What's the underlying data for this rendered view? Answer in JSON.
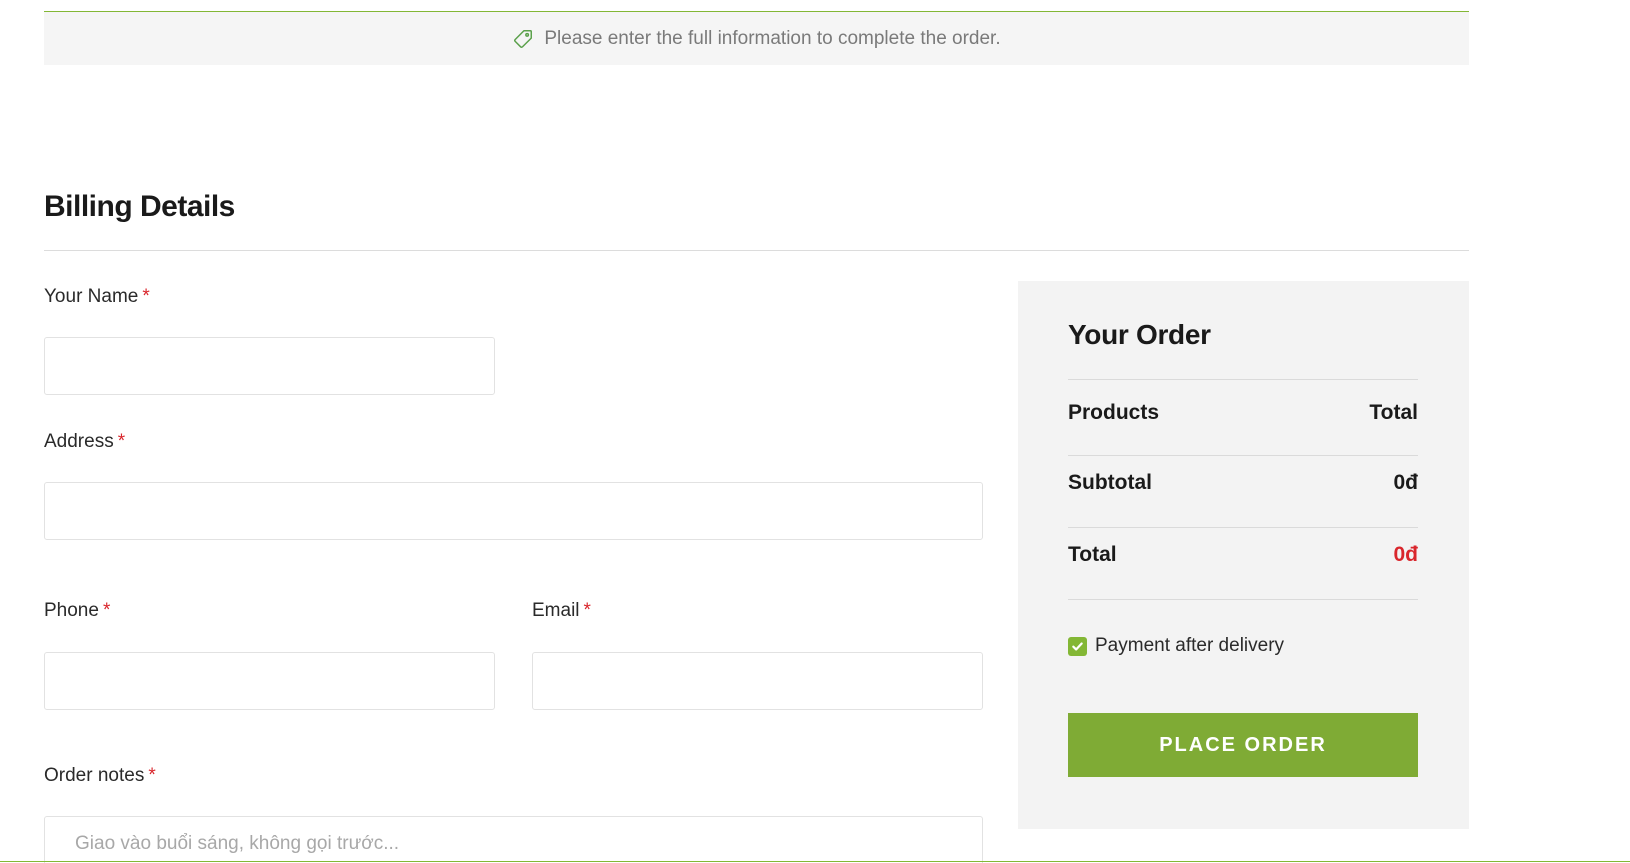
{
  "notice": {
    "icon": "tag-icon",
    "text": "Please enter the full information to complete the order."
  },
  "billing": {
    "title": "Billing Details",
    "required_mark": "*",
    "fields": {
      "name": {
        "label": "Your Name",
        "value": "",
        "placeholder": ""
      },
      "address": {
        "label": "Address",
        "value": "",
        "placeholder": ""
      },
      "phone": {
        "label": "Phone",
        "value": "",
        "placeholder": ""
      },
      "email": {
        "label": "Email",
        "value": "",
        "placeholder": ""
      },
      "notes": {
        "label": "Order notes",
        "value": "",
        "placeholder": "Giao vào buổi sáng, không gọi trước..."
      }
    }
  },
  "order": {
    "title": "Your Order",
    "products_label": "Products",
    "total_header": "Total",
    "subtotal_label": "Subtotal",
    "subtotal_value": "0đ",
    "total_label": "Total",
    "total_value": "0đ",
    "payment_label": "Payment after delivery",
    "payment_checked": true,
    "place_order_label": "PLACE ORDER"
  },
  "colors": {
    "accent_green": "#83b735",
    "button_green": "#7fab35",
    "required_red": "#d9262c",
    "panel_gray": "#f3f3f3"
  }
}
